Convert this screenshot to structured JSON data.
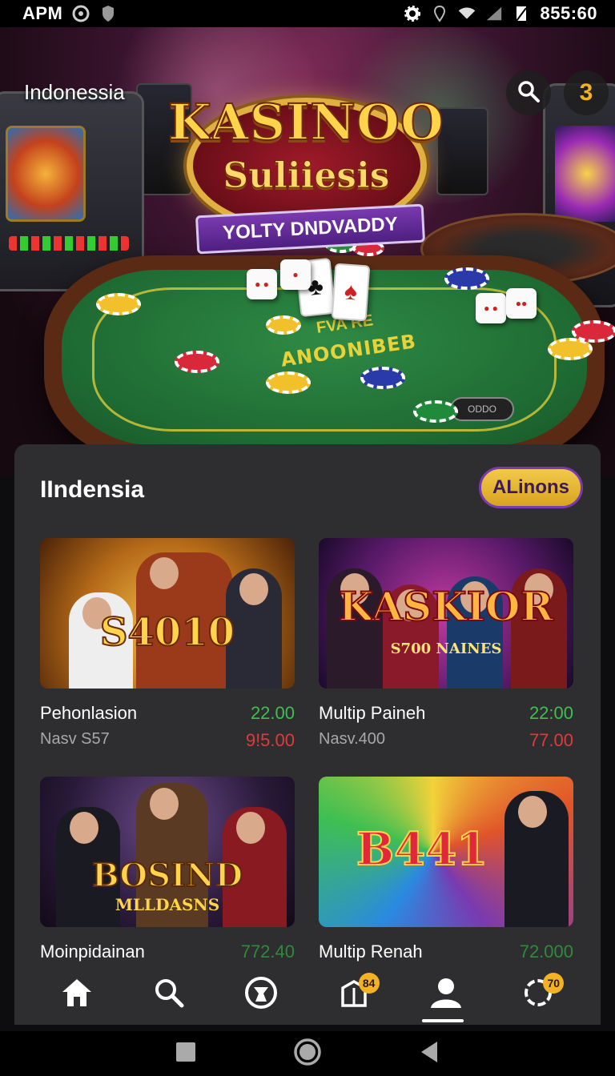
{
  "status_bar": {
    "left_text": "APM",
    "time": "855:60"
  },
  "hero": {
    "region_label": "Indonessia",
    "logo": {
      "title": "KASINOO",
      "subtitle": "Suliiesis",
      "ribbon": "YOLTY DNDVADDY"
    },
    "table_text_top": "FVA RE",
    "table_text": "ANOONIBEB",
    "profile_badge": "3"
  },
  "panel": {
    "title": "IIndensia",
    "action_button": "ALinons",
    "games": [
      {
        "thumb_text": "S4010",
        "name": "Pehonlasion",
        "sub": "Nasv S57",
        "value1": "22.00",
        "value2": "9!5.00"
      },
      {
        "thumb_text": "KASKIOR",
        "thumb_sub": "S700 NAINES",
        "name": "Multip Paineh",
        "sub": "Nasv.400",
        "value1": "22:00",
        "value2": "77.00"
      },
      {
        "thumb_text": "BOSIND",
        "thumb_sub": "MLLDASNS",
        "name": "Moinpidainan",
        "sub": "",
        "value1": "772.40",
        "value2": ""
      },
      {
        "thumb_text": "B441",
        "name": "Multip Renah",
        "sub": "",
        "value1": "72.000",
        "value2": ""
      }
    ]
  },
  "bottom_nav": {
    "items": [
      {
        "icon": "home-icon"
      },
      {
        "icon": "search-icon"
      },
      {
        "icon": "sport-ball-icon"
      },
      {
        "icon": "gift-box-icon",
        "badge": "84"
      },
      {
        "icon": "user-icon",
        "active": true
      },
      {
        "icon": "settings-icon",
        "badge": "70"
      }
    ]
  },
  "colors": {
    "accent_gold": "#f2b224",
    "positive": "#3fbf52",
    "negative": "#e03a3a",
    "panel_bg": "#2e2e30",
    "brand_purple": "#7a3ab0"
  }
}
